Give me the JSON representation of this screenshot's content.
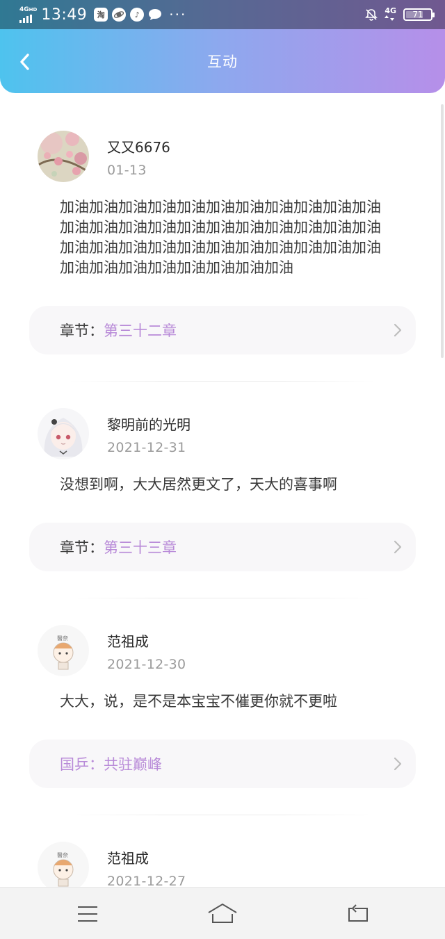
{
  "status_bar": {
    "network_left": "4G",
    "network_hd": "HD",
    "time": "13:49",
    "app_icons": [
      {
        "name": "taobao-icon",
        "glyph": "淘"
      },
      {
        "name": "planet-icon",
        "glyph": ""
      },
      {
        "name": "music-icon",
        "glyph": "♪"
      },
      {
        "name": "chat-icon",
        "glyph": ""
      }
    ],
    "more": "···",
    "network_right": "4G",
    "battery": "71",
    "battery_level": 0.71
  },
  "nav": {
    "title": "互动",
    "back_icon": "chevron-left-icon"
  },
  "colors": {
    "header_gradient": [
      "#4ec3ee",
      "#8ea8ee",
      "#b68fe9"
    ],
    "accent": "#b88ad8"
  },
  "comments": [
    {
      "name": "又又6676",
      "date": "01-13",
      "text": "加油加油加油加油加油加油加油加油加油加油加油加油加油加油加油加油加油加油加油加油加油加油加油加油加油加油加油加油加油加油加油加油加油加油加油加油加油加油加油加油加油",
      "chapter_label": "章节：",
      "chapter_value": "第三十二章",
      "avatar_icon": "avatar-flowers"
    },
    {
      "name": "黎明前的光明",
      "date": "2021-12-31",
      "text": "没想到啊，大大居然更文了，天大的喜事啊",
      "chapter_label": "章节：",
      "chapter_value": "第三十三章",
      "avatar_icon": "avatar-anime-girl"
    },
    {
      "name": "范祖成",
      "date": "2021-12-30",
      "text": "大大，说，是不是本宝宝不催更你就不更啦",
      "chapter_label": "国乒：",
      "chapter_value": "共驻巅峰",
      "avatar_icon": "avatar-cartoon"
    },
    {
      "name": "范祖成",
      "date": "2021-12-27",
      "avatar_icon": "avatar-cartoon"
    }
  ],
  "system_nav": [
    "menu-icon",
    "home-icon",
    "back-icon"
  ]
}
